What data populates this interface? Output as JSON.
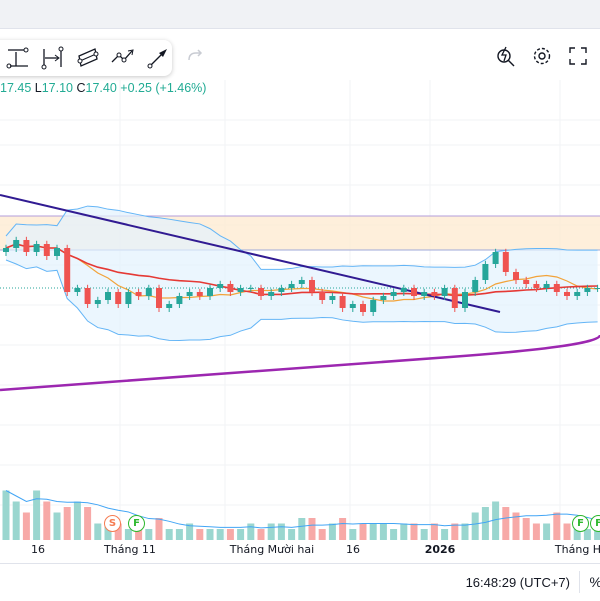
{
  "toolbar": {
    "tools": [
      "text-anchor-tool",
      "date-range-tool",
      "parallel-channel-tool",
      "path-tool",
      "arrow-tool"
    ],
    "right_icons": [
      "quick-search-icon",
      "settings-icon",
      "fullscreen-icon"
    ]
  },
  "legend": {
    "high_value": "17.45",
    "low_label": "L",
    "low_value": "17.10",
    "close_label": "C",
    "close_value": "17.40",
    "change": "+0.25 (+1.46%)"
  },
  "colors": {
    "up": "#26a69a",
    "down": "#ef5350",
    "ma_red": "#e53935",
    "ma_orange": "#f2a33a",
    "bands": "#64b5f6",
    "long_ma": "#9c27b0",
    "trend": "#311b92"
  },
  "chart_data": {
    "type": "candlestick",
    "closes": [
      18.4,
      18.6,
      18.3,
      18.5,
      18.2,
      18.4,
      17.3,
      17.4,
      17.0,
      17.1,
      17.3,
      17.0,
      17.3,
      17.2,
      17.4,
      16.9,
      17.0,
      17.2,
      17.3,
      17.2,
      17.4,
      17.5,
      17.3,
      17.4,
      17.4,
      17.2,
      17.3,
      17.4,
      17.5,
      17.6,
      17.3,
      17.1,
      17.2,
      16.9,
      17.0,
      16.8,
      17.1,
      17.2,
      17.3,
      17.4,
      17.2,
      17.3,
      17.2,
      17.4,
      16.9,
      17.3,
      17.6,
      18.0,
      18.3,
      17.8,
      17.6,
      17.5,
      17.4,
      17.5,
      17.3,
      17.2,
      17.3,
      17.4,
      17.4
    ],
    "volumes": [
      9,
      7,
      5,
      9,
      7,
      5,
      6,
      7,
      6,
      3,
      3,
      3,
      2,
      2,
      2,
      4,
      2,
      2,
      3,
      2,
      2,
      2,
      2,
      2,
      3,
      2,
      3,
      3,
      2,
      4,
      4,
      2,
      3,
      4,
      2,
      3,
      3,
      3,
      2,
      3,
      3,
      2,
      3,
      2,
      3,
      3,
      5,
      6,
      7,
      6,
      5,
      4,
      3,
      3,
      5,
      3,
      3,
      2,
      2
    ],
    "price_levels": {
      "zone_top": 19.2,
      "zone_bottom": 18.35,
      "last_close": 17.4
    },
    "x_labels": [
      {
        "text": "16",
        "bold": false
      },
      {
        "text": "Tháng 11",
        "bold": false
      },
      {
        "text": "Tháng Mười hai",
        "bold": false
      },
      {
        "text": "16",
        "bold": false
      },
      {
        "text": "2026",
        "bold": true
      },
      {
        "text": "Tháng H",
        "bold": false
      }
    ],
    "markers": [
      "S",
      "F",
      "F",
      "F"
    ]
  },
  "status": {
    "time": "16:48:29 (UTC+7)",
    "percent": "%"
  }
}
